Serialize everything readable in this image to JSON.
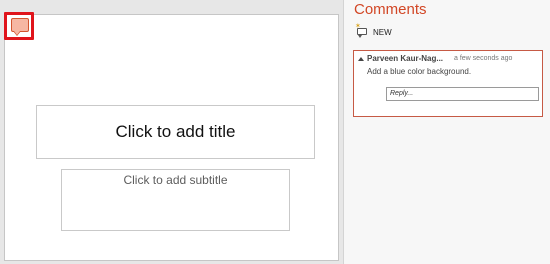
{
  "slide": {
    "title_placeholder": "Click to add title",
    "subtitle_placeholder": "Click to add subtitle"
  },
  "comments_pane": {
    "title": "Comments",
    "new_label": "NEW",
    "comments": [
      {
        "author": "Parveen Kaur-Nag...",
        "time": "a few seconds ago",
        "text": "Add a blue color background.",
        "reply_placeholder": "Reply..."
      }
    ]
  },
  "colors": {
    "accent": "#d24726",
    "highlight_border": "#e0141b",
    "comment_marker": "#f6b7a3"
  },
  "icons": [
    "comment-marker-icon",
    "new-comment-icon",
    "collapse-triangle-icon"
  ]
}
